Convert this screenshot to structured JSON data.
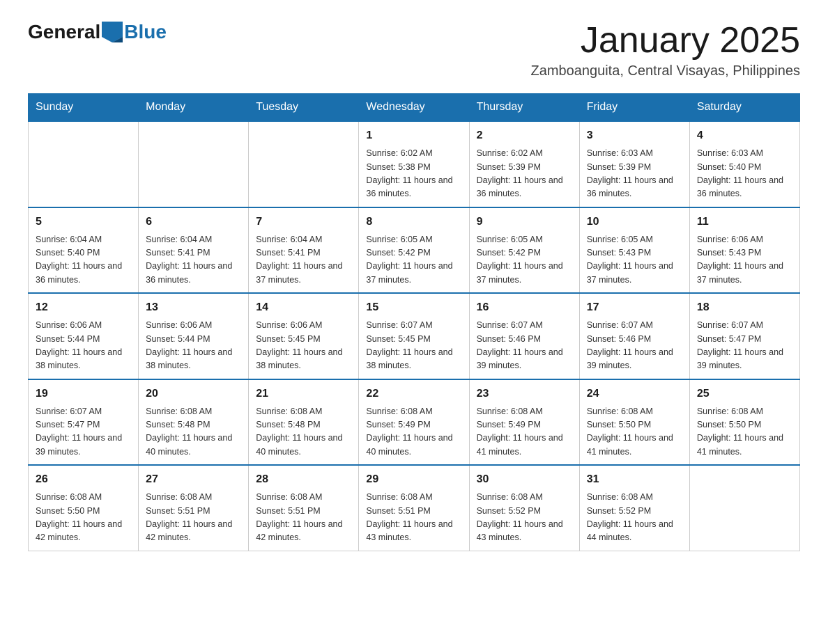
{
  "logo": {
    "general": "General",
    "blue": "Blue"
  },
  "title": "January 2025",
  "subtitle": "Zamboanguita, Central Visayas, Philippines",
  "headers": [
    "Sunday",
    "Monday",
    "Tuesday",
    "Wednesday",
    "Thursday",
    "Friday",
    "Saturday"
  ],
  "weeks": [
    [
      {
        "day": "",
        "info": ""
      },
      {
        "day": "",
        "info": ""
      },
      {
        "day": "",
        "info": ""
      },
      {
        "day": "1",
        "info": "Sunrise: 6:02 AM\nSunset: 5:38 PM\nDaylight: 11 hours and 36 minutes."
      },
      {
        "day": "2",
        "info": "Sunrise: 6:02 AM\nSunset: 5:39 PM\nDaylight: 11 hours and 36 minutes."
      },
      {
        "day": "3",
        "info": "Sunrise: 6:03 AM\nSunset: 5:39 PM\nDaylight: 11 hours and 36 minutes."
      },
      {
        "day": "4",
        "info": "Sunrise: 6:03 AM\nSunset: 5:40 PM\nDaylight: 11 hours and 36 minutes."
      }
    ],
    [
      {
        "day": "5",
        "info": "Sunrise: 6:04 AM\nSunset: 5:40 PM\nDaylight: 11 hours and 36 minutes."
      },
      {
        "day": "6",
        "info": "Sunrise: 6:04 AM\nSunset: 5:41 PM\nDaylight: 11 hours and 36 minutes."
      },
      {
        "day": "7",
        "info": "Sunrise: 6:04 AM\nSunset: 5:41 PM\nDaylight: 11 hours and 37 minutes."
      },
      {
        "day": "8",
        "info": "Sunrise: 6:05 AM\nSunset: 5:42 PM\nDaylight: 11 hours and 37 minutes."
      },
      {
        "day": "9",
        "info": "Sunrise: 6:05 AM\nSunset: 5:42 PM\nDaylight: 11 hours and 37 minutes."
      },
      {
        "day": "10",
        "info": "Sunrise: 6:05 AM\nSunset: 5:43 PM\nDaylight: 11 hours and 37 minutes."
      },
      {
        "day": "11",
        "info": "Sunrise: 6:06 AM\nSunset: 5:43 PM\nDaylight: 11 hours and 37 minutes."
      }
    ],
    [
      {
        "day": "12",
        "info": "Sunrise: 6:06 AM\nSunset: 5:44 PM\nDaylight: 11 hours and 38 minutes."
      },
      {
        "day": "13",
        "info": "Sunrise: 6:06 AM\nSunset: 5:44 PM\nDaylight: 11 hours and 38 minutes."
      },
      {
        "day": "14",
        "info": "Sunrise: 6:06 AM\nSunset: 5:45 PM\nDaylight: 11 hours and 38 minutes."
      },
      {
        "day": "15",
        "info": "Sunrise: 6:07 AM\nSunset: 5:45 PM\nDaylight: 11 hours and 38 minutes."
      },
      {
        "day": "16",
        "info": "Sunrise: 6:07 AM\nSunset: 5:46 PM\nDaylight: 11 hours and 39 minutes."
      },
      {
        "day": "17",
        "info": "Sunrise: 6:07 AM\nSunset: 5:46 PM\nDaylight: 11 hours and 39 minutes."
      },
      {
        "day": "18",
        "info": "Sunrise: 6:07 AM\nSunset: 5:47 PM\nDaylight: 11 hours and 39 minutes."
      }
    ],
    [
      {
        "day": "19",
        "info": "Sunrise: 6:07 AM\nSunset: 5:47 PM\nDaylight: 11 hours and 39 minutes."
      },
      {
        "day": "20",
        "info": "Sunrise: 6:08 AM\nSunset: 5:48 PM\nDaylight: 11 hours and 40 minutes."
      },
      {
        "day": "21",
        "info": "Sunrise: 6:08 AM\nSunset: 5:48 PM\nDaylight: 11 hours and 40 minutes."
      },
      {
        "day": "22",
        "info": "Sunrise: 6:08 AM\nSunset: 5:49 PM\nDaylight: 11 hours and 40 minutes."
      },
      {
        "day": "23",
        "info": "Sunrise: 6:08 AM\nSunset: 5:49 PM\nDaylight: 11 hours and 41 minutes."
      },
      {
        "day": "24",
        "info": "Sunrise: 6:08 AM\nSunset: 5:50 PM\nDaylight: 11 hours and 41 minutes."
      },
      {
        "day": "25",
        "info": "Sunrise: 6:08 AM\nSunset: 5:50 PM\nDaylight: 11 hours and 41 minutes."
      }
    ],
    [
      {
        "day": "26",
        "info": "Sunrise: 6:08 AM\nSunset: 5:50 PM\nDaylight: 11 hours and 42 minutes."
      },
      {
        "day": "27",
        "info": "Sunrise: 6:08 AM\nSunset: 5:51 PM\nDaylight: 11 hours and 42 minutes."
      },
      {
        "day": "28",
        "info": "Sunrise: 6:08 AM\nSunset: 5:51 PM\nDaylight: 11 hours and 42 minutes."
      },
      {
        "day": "29",
        "info": "Sunrise: 6:08 AM\nSunset: 5:51 PM\nDaylight: 11 hours and 43 minutes."
      },
      {
        "day": "30",
        "info": "Sunrise: 6:08 AM\nSunset: 5:52 PM\nDaylight: 11 hours and 43 minutes."
      },
      {
        "day": "31",
        "info": "Sunrise: 6:08 AM\nSunset: 5:52 PM\nDaylight: 11 hours and 44 minutes."
      },
      {
        "day": "",
        "info": ""
      }
    ]
  ]
}
